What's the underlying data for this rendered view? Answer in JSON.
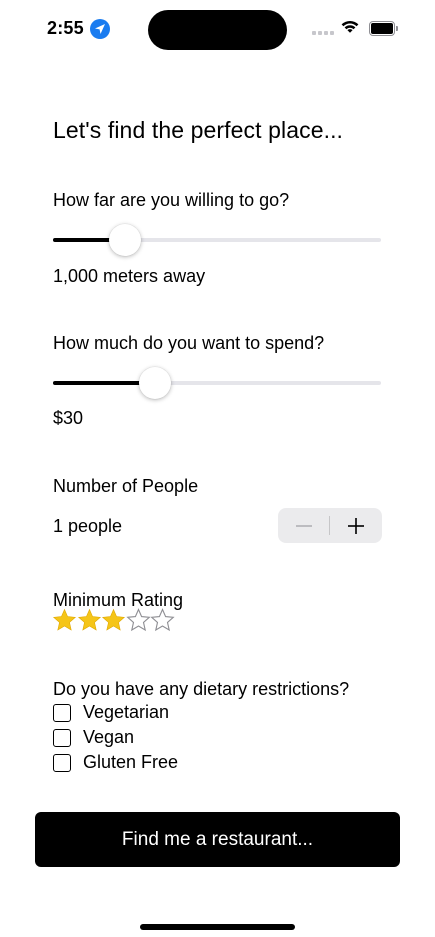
{
  "status_bar": {
    "time": "2:55",
    "location_icon": "location-arrow-icon",
    "wifi_icon": "wifi-icon",
    "battery_icon": "battery-icon",
    "battery_level": 1.0
  },
  "headline": "Let's find the perfect place...",
  "distance": {
    "label": "How far are you willing to go?",
    "value_text": "1,000 meters away",
    "slider_fraction": 0.22
  },
  "budget": {
    "label": "How much do you want to spend?",
    "value_text": "$30",
    "slider_fraction": 0.31
  },
  "people": {
    "label": "Number of People",
    "value_text": "1 people",
    "stepper_minus_icon": "minus-icon",
    "stepper_plus_icon": "plus-icon"
  },
  "rating": {
    "label": "Minimum Rating",
    "selected": 3,
    "max": 5,
    "filled_color": "#f5c518",
    "empty_icon": "star-outline-icon",
    "filled_icon": "star-filled-icon"
  },
  "dietary": {
    "label": "Do you have any dietary restrictions?",
    "options": [
      {
        "label": "Vegetarian",
        "checked": false
      },
      {
        "label": "Vegan",
        "checked": false
      },
      {
        "label": "Gluten Free",
        "checked": false
      }
    ]
  },
  "cta": {
    "label": "Find me a restaurant..."
  }
}
